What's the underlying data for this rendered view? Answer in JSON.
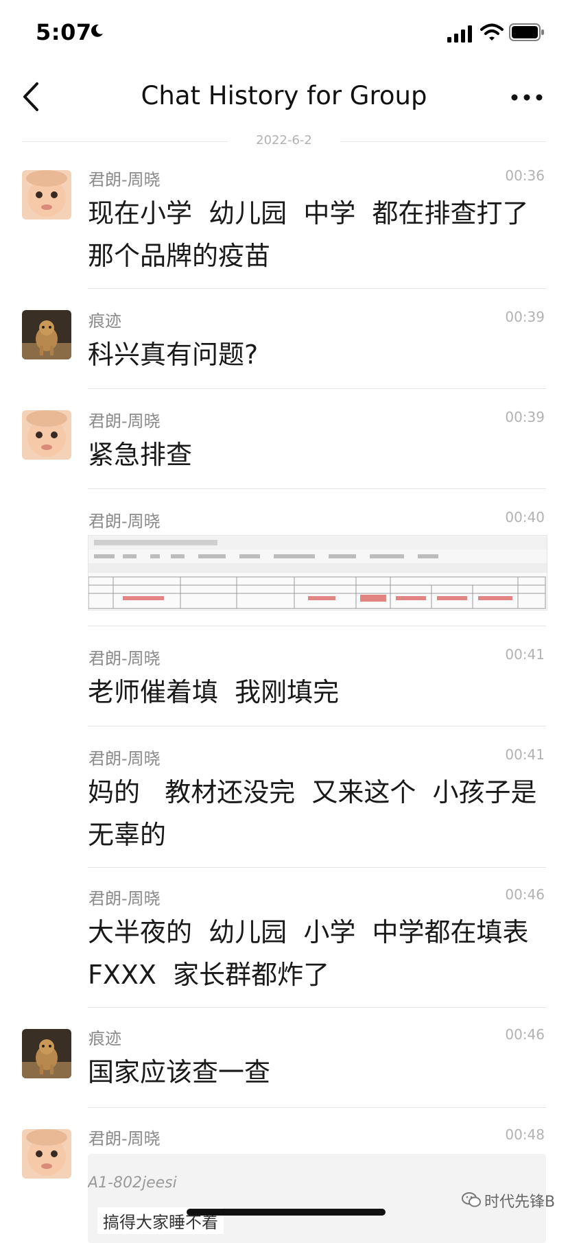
{
  "status_bar": {
    "time": "5:07"
  },
  "nav": {
    "title": "Chat History for Group"
  },
  "date_separator": "2022-6-2",
  "messages": [
    {
      "sender": "君朗-周晓",
      "time": "00:36",
      "text": "现在小学  幼儿园  中学  都在排查打了那个品牌的疫苗",
      "avatar": "baby-avatar"
    },
    {
      "sender": "痕迹",
      "time": "00:39",
      "text": "科兴真有问题?",
      "avatar": "lion-avatar"
    },
    {
      "sender": "君朗-周晓",
      "time": "00:39",
      "text": "紧急排查",
      "avatar": "baby-avatar"
    },
    {
      "sender": "君朗-周晓",
      "time": "00:40",
      "text": "",
      "attachment": "spreadsheet-image"
    },
    {
      "sender": "君朗-周晓",
      "time": "00:41",
      "text": "老师催着填  我刚填完"
    },
    {
      "sender": "君朗-周晓",
      "time": "00:41",
      "text": "妈的   教材还没完  又来这个  小孩子是无辜的"
    },
    {
      "sender": "君朗-周晓",
      "time": "00:46",
      "text": "大半夜的  幼儿园  小学  中学都在填表  FXXX  家长群都炸了"
    },
    {
      "sender": "痕迹",
      "time": "00:46",
      "text": "国家应该查一查",
      "avatar": "lion-avatar"
    },
    {
      "sender": "君朗-周晓",
      "time": "00:48",
      "text": "",
      "avatar": "baby-avatar",
      "attachment": "quoted-image"
    }
  ],
  "quoted_image": {
    "code": "A1-802jeesi",
    "caption": "搞得大家睡不着"
  },
  "watermark": {
    "text": "时代先锋B"
  },
  "colors": {
    "background": "#ffffff",
    "secondary_text": "#8a8a8a",
    "timestamp": "#b2b2b2",
    "divider": "#e5e5e5"
  }
}
